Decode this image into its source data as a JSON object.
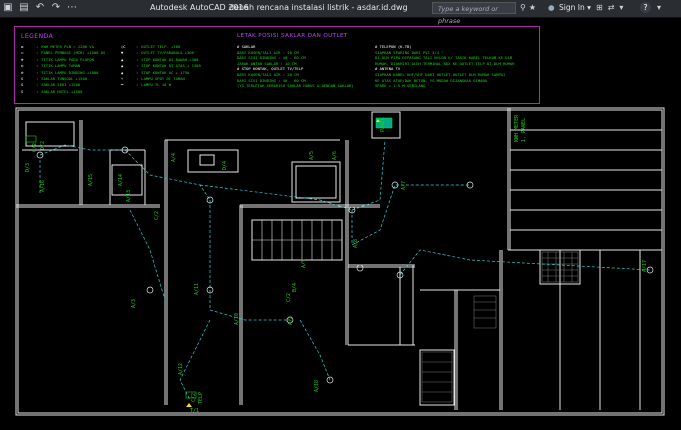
{
  "titlebar": {
    "app_title": "Autodesk AutoCAD 2016",
    "doc_title": "denah rencana instalasi listrik - asdar.id.dwg",
    "search_placeholder": "Type a keyword or phrase",
    "signin_label": "Sign In"
  },
  "icons": [
    "save-icon",
    "undo-icon",
    "redo-icon",
    "search-icon",
    "binoculars-icon",
    "star-icon",
    "person-icon",
    "cart-icon",
    "exchange-icon",
    "help-icon"
  ],
  "legend": {
    "title": "LEGENDA",
    "col1": [
      {
        "sym": "▬",
        "label": "KWH METER PLN = 2200 VA"
      },
      {
        "sym": "▭",
        "label": "PANEL PEMBAGI (MCB) +1500 AS"
      },
      {
        "sym": "⊕",
        "label": "TITIK LAMPU PADA PLAFON"
      },
      {
        "sym": "◎",
        "label": "TITIK LAMPU TAMAN"
      },
      {
        "sym": "⊗",
        "label": "TITIK LAMPU DINDING +1800"
      },
      {
        "sym": "S",
        "label": "SAKLAR TUNGGAL +1500"
      },
      {
        "sym": "S",
        "label": "SAKLAR SERI +1500"
      },
      {
        "sym": "S",
        "label": "SAKLAR HOTEL +1500"
      }
    ],
    "col2": [
      {
        "sym": "○C",
        "label": "OUTLET TELP. +300"
      },
      {
        "sym": "▼",
        "label": "OUTLET TV/PARABOLA +300"
      },
      {
        "sym": "▲",
        "label": "STOP KONTAK DI BAWAH +300"
      },
      {
        "sym": "▲",
        "label": "STOP KONTAK DI ATAS + 1300"
      },
      {
        "sym": "▲",
        "label": "STOP KONTAK AC + 1750"
      },
      {
        "sym": "☼",
        "label": "LAMPU SPOT DI TAMAN"
      },
      {
        "sym": "━",
        "label": "LAMPU TL 18 W"
      }
    ]
  },
  "ketentuan": {
    "title": "LETAK POSISI SAKLAR DAN OUTLET",
    "col1": [
      {
        "hdr": true,
        "label": "# SAKLAR"
      },
      {
        "hdr": false,
        "label": "DARI KUSEN/TALI AIR          :   20 CM"
      },
      {
        "hdr": false,
        "label": "DARI SISI DINDING            :   40 - 60 CM"
      },
      {
        "hdr": false,
        "label": "JARAK ANTAR SAKLAR           :   10 CM"
      },
      {
        "hdr": true,
        "label": "# STOP KONTAK, OUTLET TV/TELP"
      },
      {
        "hdr": false,
        "label": "DARI KUSEN/TALI AIR          :   20 CM"
      },
      {
        "hdr": false,
        "label": "DARI SISI DINDING            :   40 - 60 CM"
      },
      {
        "hdr": false,
        "label": "(YG TERLETAK SEBARISH SAKLAR HARUS & DENGAN SAKLAR)"
      }
    ],
    "col2": [
      {
        "hdr": true,
        "label": "# TELEPON (K.TB)"
      },
      {
        "hdr": false,
        "label": "SIAPKAN SPARING DARI PVC 3/4 \""
      },
      {
        "hdr": false,
        "label": "DI DLM PIPA DIPASANG TALI NYLON U/ TARIK KABEL TELKOM KE DLM"
      },
      {
        "hdr": false,
        "label": "RUMAH, DIAKHIRI OLEH TERMINAL BOX KE OUTLET TELP DI DLM RUMAH"
      },
      {
        "hdr": true,
        "label": "# ANTENA TV"
      },
      {
        "hdr": false,
        "label": "SIAPKAN KABEL UHF/VHF DARI OUTLET-OUTLET DLM RUMAH SAMPAI"
      },
      {
        "hdr": false,
        "label": "KE ATAS ATAP/DAK BETON, YG MUDAH DIJANGKAU DIMANA"
      },
      {
        "hdr": false,
        "label": "SPARE = 1.5 M SEBILANG"
      }
    ]
  },
  "plan_labels": {
    "kwh": "KWH METER",
    "kwh_sub": "1. PANEL",
    "panel": "PANEL",
    "a2": "A/2",
    "a3": "A/3",
    "a4": "A/4",
    "a5": "A/5",
    "a6": "A/6",
    "a7": "A/7",
    "a8": "A/8",
    "a9": "A/9",
    "a10": "A/10",
    "a11": "A/11",
    "a12": "A/12",
    "a13": "A/13",
    "a14": "A/14",
    "a15": "A/15",
    "a16": "A/16",
    "a17": "A/17",
    "a18": "A/18",
    "a1": "A/1",
    "c2": "C/2",
    "d2": "D/2",
    "d3": "D/3",
    "d4": "D/4",
    "b4": "B/4",
    "b3": "B/3",
    "t1": "T/1",
    "telp": "TELP"
  }
}
